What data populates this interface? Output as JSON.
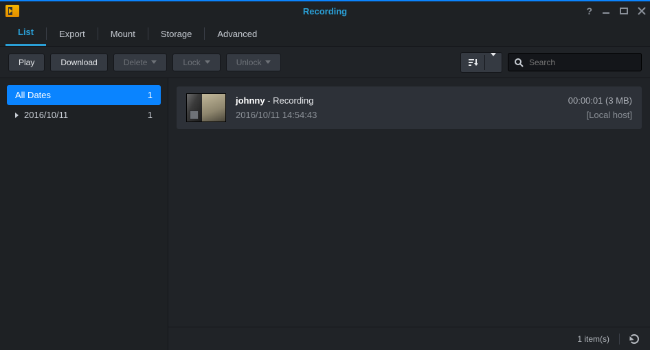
{
  "header": {
    "title": "Recording"
  },
  "tabs": [
    "List",
    "Export",
    "Mount",
    "Storage",
    "Advanced"
  ],
  "toolbar": {
    "play": "Play",
    "download": "Download",
    "delete": "Delete",
    "lock": "Lock",
    "unlock": "Unlock",
    "search_placeholder": "Search"
  },
  "sidebar": {
    "items": [
      {
        "label": "All Dates",
        "count": "1"
      },
      {
        "label": "2016/10/11",
        "count": "1"
      }
    ]
  },
  "recordings": [
    {
      "name": "johnny",
      "type": "Recording",
      "timestamp": "2016/10/11 14:54:43",
      "duration": "00:00:01",
      "size": "3 MB",
      "host": "Local host"
    }
  ],
  "status": {
    "item_count": "1 item(s)"
  }
}
